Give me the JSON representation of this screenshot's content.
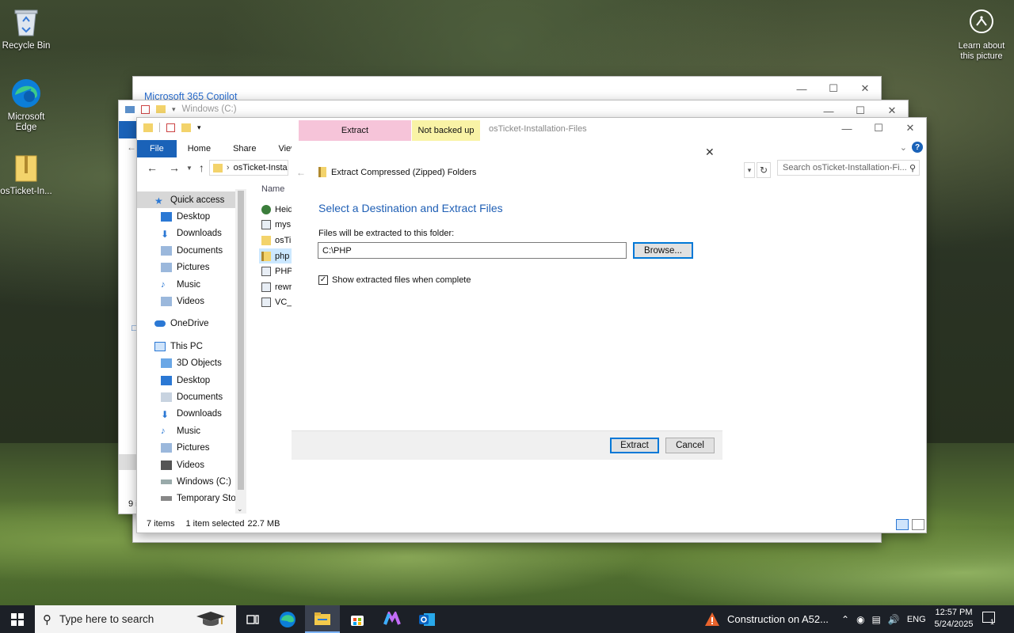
{
  "desktop": {
    "icons": [
      {
        "label": "Recycle Bin"
      },
      {
        "label": "Microsoft Edge"
      },
      {
        "label": "osTicket-In..."
      }
    ],
    "learn_about": "Learn about this picture"
  },
  "back_window_1": {
    "title": "Microsoft 365 Copilot"
  },
  "back_window_2": {
    "title": "Windows (C:)",
    "status_fragment": "9 i"
  },
  "explorer": {
    "context_tab_extract": "Extract",
    "context_tab_not_backed": "Not backed up",
    "title": "osTicket-Installation-Files",
    "ribbon_tabs": [
      "File",
      "Home",
      "Share",
      "View"
    ],
    "address_fragment": "osTicket-Insta",
    "search_placeholder": "Search osTicket-Installation-Fi...",
    "column_name": "Name",
    "files": [
      "Heid",
      "mys",
      "osTi",
      "php",
      "PHP",
      "rewr",
      "VC_"
    ],
    "nav": {
      "quick_access": "Quick access",
      "qa_items": [
        "Desktop",
        "Downloads",
        "Documents",
        "Pictures",
        "Music",
        "Videos"
      ],
      "onedrive": "OneDrive",
      "this_pc": "This PC",
      "pc_items": [
        "3D Objects",
        "Desktop",
        "Documents",
        "Downloads",
        "Music",
        "Pictures",
        "Videos",
        "Windows (C:)",
        "Temporary Stora"
      ]
    },
    "status": {
      "items": "7 items",
      "selected": "1 item selected",
      "size": "22.7 MB"
    }
  },
  "dialog": {
    "header": "Extract Compressed (Zipped) Folders",
    "heading": "Select a Destination and Extract Files",
    "folder_label": "Files will be extracted to this folder:",
    "folder_value": "C:\\PHP",
    "browse": "Browse...",
    "checkbox_label": "Show extracted files when complete",
    "checkbox_checked": true,
    "extract": "Extract",
    "cancel": "Cancel"
  },
  "taskbar": {
    "search_placeholder": "Type here to search",
    "weather": "Construction on A52...",
    "lang": "ENG",
    "time": "12:57 PM",
    "date": "5/24/2025",
    "notif_count": "1"
  },
  "colors": {
    "accent": "#1a62b8",
    "link_blue": "#1f5fb5",
    "extract_tab": "#f6c4d9",
    "not_backed_tab": "#f9f3a6"
  }
}
